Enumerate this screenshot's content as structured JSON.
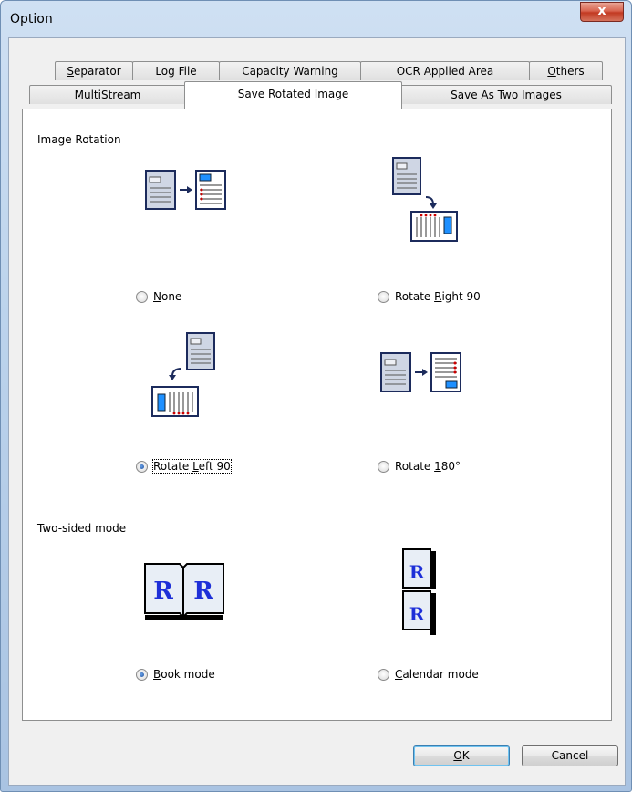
{
  "window": {
    "title": "Option",
    "close_glyph": "x"
  },
  "tabs_row1": [
    {
      "label": "Separator",
      "mnemonic": "S",
      "rest": "eparator"
    },
    {
      "label": "Log File"
    },
    {
      "label": "Capacity Warning"
    },
    {
      "label": "OCR Applied Area"
    },
    {
      "label": "Others",
      "mnemonic": "O",
      "rest": "thers"
    }
  ],
  "tabs_row2": [
    {
      "label": "MultiStream"
    },
    {
      "label": "Save Rotated Image",
      "before": "Save Rota",
      "mnemonic": "t",
      "after": "ed Image",
      "active": true
    },
    {
      "label": "Save As Two Images"
    }
  ],
  "image_rotation": {
    "heading": "Image Rotation",
    "options": [
      {
        "label": "None",
        "mnemonic": "N",
        "rest": "one",
        "checked": false,
        "icon": "rotation-none-icon"
      },
      {
        "label": "Rotate Right 90",
        "before": "Rotate ",
        "mnemonic": "R",
        "rest": "ight 90",
        "checked": false,
        "icon": "rotate-right-90-icon"
      },
      {
        "label": "Rotate Left 90",
        "before": "Rotate ",
        "mnemonic": "L",
        "rest": "eft 90",
        "checked": true,
        "icon": "rotate-left-90-icon"
      },
      {
        "label": "Rotate 180°",
        "before": "Rotate ",
        "mnemonic": "1",
        "rest": "80°",
        "checked": false,
        "icon": "rotate-180-icon"
      }
    ]
  },
  "two_sided": {
    "heading": "Two-sided mode",
    "book_letters": [
      "R",
      "R"
    ],
    "options": [
      {
        "label": "Book mode",
        "mnemonic": "B",
        "rest": "ook mode",
        "checked": true,
        "icon": "book-mode-icon"
      },
      {
        "label": "Calendar mode",
        "mnemonic": "C",
        "rest": "alendar mode",
        "checked": false,
        "icon": "calendar-mode-icon"
      }
    ]
  },
  "buttons": {
    "ok": "OK",
    "ok_mnemonic": "O",
    "ok_rest": "K",
    "cancel": "Cancel"
  },
  "colors": {
    "accent_blue": "#1e90ff",
    "doc_red": "#cc0000",
    "letter_blue": "#1d2fd8",
    "doc_border": "#1c2b5c"
  }
}
